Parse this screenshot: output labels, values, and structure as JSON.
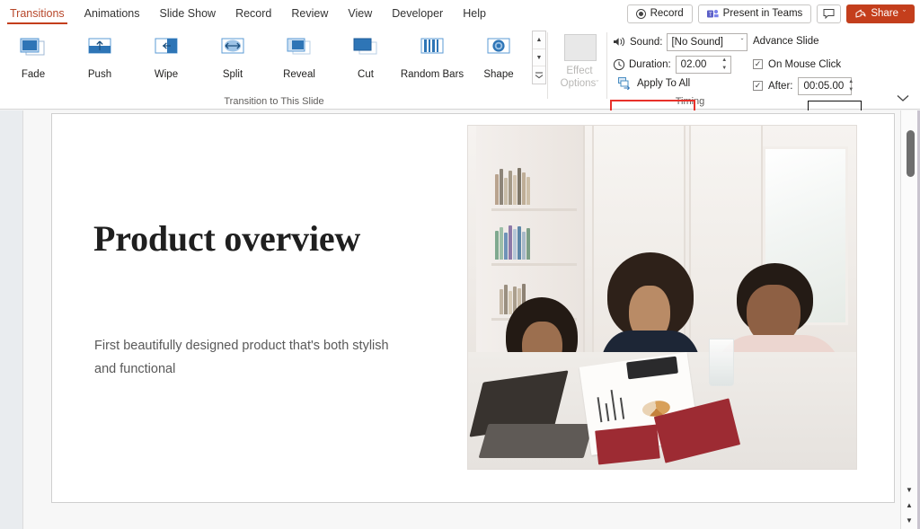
{
  "ribbon_tabs": [
    {
      "label": "Transitions",
      "active": true
    },
    {
      "label": "Animations",
      "active": false
    },
    {
      "label": "Slide Show",
      "active": false
    },
    {
      "label": "Record",
      "active": false
    },
    {
      "label": "Review",
      "active": false
    },
    {
      "label": "View",
      "active": false
    },
    {
      "label": "Developer",
      "active": false
    },
    {
      "label": "Help",
      "active": false
    }
  ],
  "titlebar_actions": {
    "record_label": "Record",
    "record_icon": "record-circle-icon",
    "present_in_teams_label": "Present in Teams",
    "teams_icon": "teams-icon",
    "comments_icon": "comment-icon",
    "share_label": "Share",
    "share_icon": "share-icon",
    "share_caret": "ˇ",
    "share_color": "#c43e1c"
  },
  "transition_group": {
    "label": "Transition to This Slide",
    "items": [
      {
        "label": "Fade",
        "icon": "fade-transition-icon"
      },
      {
        "label": "Push",
        "icon": "push-transition-icon"
      },
      {
        "label": "Wipe",
        "icon": "wipe-transition-icon"
      },
      {
        "label": "Split",
        "icon": "split-transition-icon"
      },
      {
        "label": "Reveal",
        "icon": "reveal-transition-icon"
      },
      {
        "label": "Cut",
        "icon": "cut-transition-icon"
      },
      {
        "label": "Random Bars",
        "icon": "random-bars-transition-icon"
      },
      {
        "label": "Shape",
        "icon": "shape-transition-icon"
      }
    ],
    "scroll_up": "▲",
    "scroll_down": "▼",
    "scroll_more": "▼"
  },
  "effect_options": {
    "line1": "Effect",
    "line2": "Options",
    "caret": "ˇ",
    "enabled": false
  },
  "timing_group": {
    "label": "Timing",
    "sound_icon": "sound-icon",
    "sound_label": "Sound:",
    "sound_value": "[No Sound]",
    "sound_caret": "ˇ",
    "duration_icon": "clock-icon",
    "duration_label": "Duration:",
    "duration_value": "02.00",
    "apply_to_all_label": "Apply To All",
    "apply_to_all_icon": "apply-to-all-icon",
    "apply_to_all_highlight_color": "#e8312a",
    "advance_slide_label": "Advance Slide",
    "on_mouse_click_label": "On Mouse Click",
    "on_mouse_click_checked": true,
    "after_label": "After:",
    "after_checked": true,
    "after_value": "00:05.00",
    "checkmark": "✓",
    "spin_up": "▲",
    "spin_down": "▼"
  },
  "ribbon_collapse_caret": "ˇ",
  "slide": {
    "title": "Product overview",
    "subtitle": "First beautifully designed product that's both stylish and functional",
    "image_alt": "three-colleagues-meeting-at-table-photo"
  },
  "scroll": {
    "thumb": "vertical-scroll-thumb",
    "prev_slide": "▼",
    "next_slide": "▲",
    "back_to_slide": "▼"
  }
}
